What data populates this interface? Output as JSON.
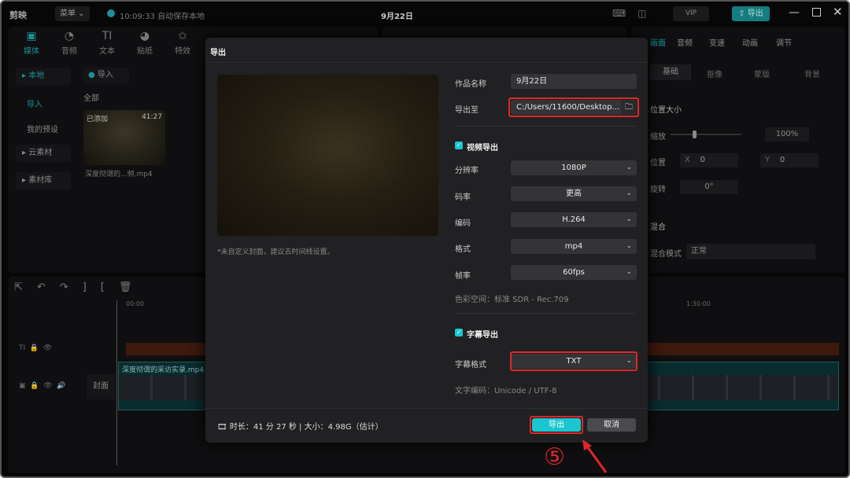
{
  "app": {
    "logo": "剪映",
    "menu_label": "菜单",
    "autosave": "10:09:33 自动保存本地",
    "project_title": "9月22日",
    "vip": "VIP",
    "export_label": "导出"
  },
  "media_tools": [
    {
      "label": "媒体",
      "icon": "media-icon",
      "glyph": "▣"
    },
    {
      "label": "音频",
      "icon": "audio-icon",
      "glyph": "◔"
    },
    {
      "label": "文本",
      "icon": "text-icon",
      "glyph": "TI"
    },
    {
      "label": "贴纸",
      "icon": "sticker-icon",
      "glyph": "◕"
    },
    {
      "label": "特效",
      "icon": "effects-icon",
      "glyph": "✩"
    }
  ],
  "left_nav": [
    {
      "label": "本地"
    },
    {
      "label": "导入"
    },
    {
      "label": "我的预设"
    },
    {
      "label": "云素材"
    },
    {
      "label": "素材库"
    }
  ],
  "media": {
    "import_label": "导入",
    "all_label": "全部",
    "clip": {
      "badge": "已添加",
      "duration": "41:27",
      "name": "深度彻谓的...频.mp4"
    }
  },
  "right_panel": {
    "tabs": [
      "画面",
      "音频",
      "变速",
      "动画",
      "调节"
    ],
    "subtabs": [
      "基础",
      "抠像",
      "蒙版",
      "背景"
    ],
    "section_position": "位置大小",
    "scale_label": "缩放",
    "scale_value": "100%",
    "pos_label": "位置",
    "x_label": "X",
    "x_value": "0",
    "y_label": "Y",
    "y_value": "0",
    "rotate_label": "旋转",
    "rotate_value": "0°",
    "section_blend": "混合",
    "blend_mode_label": "混合模式",
    "blend_mode_value": "正常"
  },
  "timeline": {
    "start_time": "00:00",
    "mid_time": "1:30:00",
    "clip_name": "深度彻谓的采访实录.mp4",
    "cover_label": "封面"
  },
  "dialog": {
    "title": "导出",
    "cover_hint": "*未自定义封面，建议去时间线设置。",
    "name_label": "作品名称",
    "name_value": "9月22日",
    "path_label": "导出至",
    "path_value": "C:/Users/11600/Desktop...",
    "video_export_label": "视频导出",
    "video_export_checked": true,
    "resolution_label": "分辨率",
    "resolution_value": "1080P",
    "bitrate_label": "码率",
    "bitrate_value": "更高",
    "codec_label": "编码",
    "codec_value": "H.264",
    "format_label": "格式",
    "format_value": "mp4",
    "fps_label": "帧率",
    "fps_value": "60fps",
    "color_space": "色彩空间：标准 SDR - Rec.709",
    "subtitle_export_label": "字幕导出",
    "subtitle_export_checked": true,
    "subtitle_format_label": "字幕格式",
    "subtitle_format_value": "TXT",
    "text_encoding": "文字编码：Unicode / UTF-8",
    "info": "时长：41 分 27 秒 | 大小：4.98G（估计）",
    "export_button": "导出",
    "cancel_button": "取消"
  },
  "annotation": {
    "step": "⑤"
  },
  "colors": {
    "accent": "#1bc6d0",
    "highlight": "#e0262a",
    "background": "#0c0c0e",
    "dialog": "#212123"
  }
}
